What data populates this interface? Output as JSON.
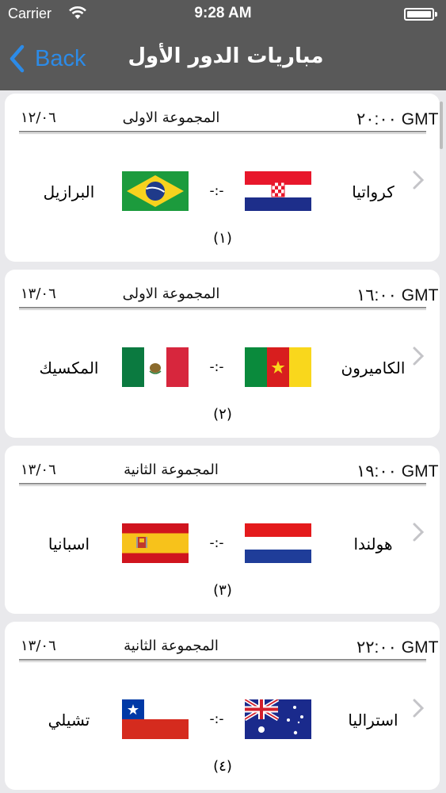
{
  "status": {
    "carrier": "Carrier",
    "time": "9:28 AM"
  },
  "nav": {
    "back_label": "Back",
    "title": "مباريات الدور الأول"
  },
  "colors": {
    "accent": "#2c8be8",
    "bar": "#595959",
    "background": "#e9e9ec"
  },
  "matches": [
    {
      "time": "٢٠:٠٠ GMT",
      "group": "المجموعة الاولى",
      "date": "١٢/٠٦",
      "team1": "كرواتيا",
      "flag1": "croatia-flag",
      "score": "-:-",
      "team2": "البرازيل",
      "flag2": "brazil-flag",
      "number": "(١)"
    },
    {
      "time": "١٦:٠٠ GMT",
      "group": "المجموعة الاولى",
      "date": "١٣/٠٦",
      "team1": "الكاميرون",
      "flag1": "cameroon-flag",
      "score": "-:-",
      "team2": "المكسيك",
      "flag2": "mexico-flag",
      "number": "(٢)"
    },
    {
      "time": "١٩:٠٠ GMT",
      "group": "المجموعة الثانية",
      "date": "١٣/٠٦",
      "team1": "هولندا",
      "flag1": "netherlands-flag",
      "score": "-:-",
      "team2": "اسبانيا",
      "flag2": "spain-flag",
      "number": "(٣)"
    },
    {
      "time": "٢٢:٠٠ GMT",
      "group": "المجموعة الثانية",
      "date": "١٣/٠٦",
      "team1": "استراليا",
      "flag1": "australia-flag",
      "score": "-:-",
      "team2": "تشيلي",
      "flag2": "chile-flag",
      "number": "(٤)"
    }
  ]
}
